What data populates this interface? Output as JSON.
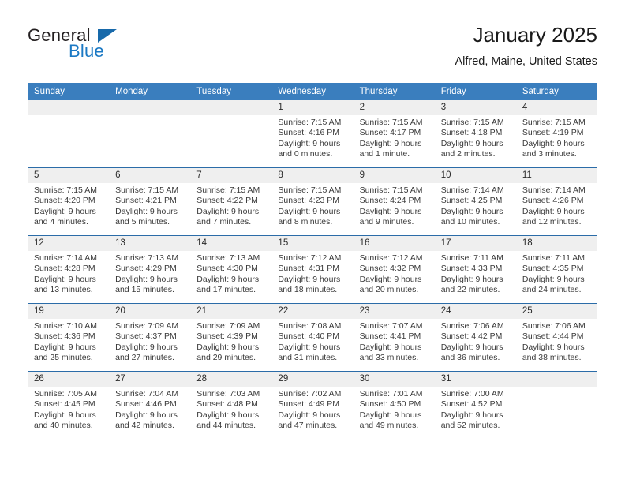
{
  "brand": {
    "name_top": "General",
    "name_bottom": "Blue",
    "color_dark": "#231f20",
    "color_blue": "#1b79c4",
    "triangle_color": "#1769aa"
  },
  "header": {
    "title": "January 2025",
    "subtitle": "Alfred, Maine, United States"
  },
  "theme": {
    "header_row_bg": "#3a7ebe",
    "header_row_text": "#ffffff",
    "daynum_bg": "#efefef",
    "grid_line": "#2b6ca8"
  },
  "weekdays": [
    "Sunday",
    "Monday",
    "Tuesday",
    "Wednesday",
    "Thursday",
    "Friday",
    "Saturday"
  ],
  "labels": {
    "sunrise_prefix": "Sunrise:",
    "sunset_prefix": "Sunset:",
    "daylight_prefix": "Daylight:"
  },
  "weeks": [
    [
      {
        "day": "",
        "empty": true
      },
      {
        "day": "",
        "empty": true
      },
      {
        "day": "",
        "empty": true
      },
      {
        "day": "1",
        "sunrise": "Sunrise: 7:15 AM",
        "sunset": "Sunset: 4:16 PM",
        "daylight": "Daylight: 9 hours and 0 minutes."
      },
      {
        "day": "2",
        "sunrise": "Sunrise: 7:15 AM",
        "sunset": "Sunset: 4:17 PM",
        "daylight": "Daylight: 9 hours and 1 minute."
      },
      {
        "day": "3",
        "sunrise": "Sunrise: 7:15 AM",
        "sunset": "Sunset: 4:18 PM",
        "daylight": "Daylight: 9 hours and 2 minutes."
      },
      {
        "day": "4",
        "sunrise": "Sunrise: 7:15 AM",
        "sunset": "Sunset: 4:19 PM",
        "daylight": "Daylight: 9 hours and 3 minutes."
      }
    ],
    [
      {
        "day": "5",
        "sunrise": "Sunrise: 7:15 AM",
        "sunset": "Sunset: 4:20 PM",
        "daylight": "Daylight: 9 hours and 4 minutes."
      },
      {
        "day": "6",
        "sunrise": "Sunrise: 7:15 AM",
        "sunset": "Sunset: 4:21 PM",
        "daylight": "Daylight: 9 hours and 5 minutes."
      },
      {
        "day": "7",
        "sunrise": "Sunrise: 7:15 AM",
        "sunset": "Sunset: 4:22 PM",
        "daylight": "Daylight: 9 hours and 7 minutes."
      },
      {
        "day": "8",
        "sunrise": "Sunrise: 7:15 AM",
        "sunset": "Sunset: 4:23 PM",
        "daylight": "Daylight: 9 hours and 8 minutes."
      },
      {
        "day": "9",
        "sunrise": "Sunrise: 7:15 AM",
        "sunset": "Sunset: 4:24 PM",
        "daylight": "Daylight: 9 hours and 9 minutes."
      },
      {
        "day": "10",
        "sunrise": "Sunrise: 7:14 AM",
        "sunset": "Sunset: 4:25 PM",
        "daylight": "Daylight: 9 hours and 10 minutes."
      },
      {
        "day": "11",
        "sunrise": "Sunrise: 7:14 AM",
        "sunset": "Sunset: 4:26 PM",
        "daylight": "Daylight: 9 hours and 12 minutes."
      }
    ],
    [
      {
        "day": "12",
        "sunrise": "Sunrise: 7:14 AM",
        "sunset": "Sunset: 4:28 PM",
        "daylight": "Daylight: 9 hours and 13 minutes."
      },
      {
        "day": "13",
        "sunrise": "Sunrise: 7:13 AM",
        "sunset": "Sunset: 4:29 PM",
        "daylight": "Daylight: 9 hours and 15 minutes."
      },
      {
        "day": "14",
        "sunrise": "Sunrise: 7:13 AM",
        "sunset": "Sunset: 4:30 PM",
        "daylight": "Daylight: 9 hours and 17 minutes."
      },
      {
        "day": "15",
        "sunrise": "Sunrise: 7:12 AM",
        "sunset": "Sunset: 4:31 PM",
        "daylight": "Daylight: 9 hours and 18 minutes."
      },
      {
        "day": "16",
        "sunrise": "Sunrise: 7:12 AM",
        "sunset": "Sunset: 4:32 PM",
        "daylight": "Daylight: 9 hours and 20 minutes."
      },
      {
        "day": "17",
        "sunrise": "Sunrise: 7:11 AM",
        "sunset": "Sunset: 4:33 PM",
        "daylight": "Daylight: 9 hours and 22 minutes."
      },
      {
        "day": "18",
        "sunrise": "Sunrise: 7:11 AM",
        "sunset": "Sunset: 4:35 PM",
        "daylight": "Daylight: 9 hours and 24 minutes."
      }
    ],
    [
      {
        "day": "19",
        "sunrise": "Sunrise: 7:10 AM",
        "sunset": "Sunset: 4:36 PM",
        "daylight": "Daylight: 9 hours and 25 minutes."
      },
      {
        "day": "20",
        "sunrise": "Sunrise: 7:09 AM",
        "sunset": "Sunset: 4:37 PM",
        "daylight": "Daylight: 9 hours and 27 minutes."
      },
      {
        "day": "21",
        "sunrise": "Sunrise: 7:09 AM",
        "sunset": "Sunset: 4:39 PM",
        "daylight": "Daylight: 9 hours and 29 minutes."
      },
      {
        "day": "22",
        "sunrise": "Sunrise: 7:08 AM",
        "sunset": "Sunset: 4:40 PM",
        "daylight": "Daylight: 9 hours and 31 minutes."
      },
      {
        "day": "23",
        "sunrise": "Sunrise: 7:07 AM",
        "sunset": "Sunset: 4:41 PM",
        "daylight": "Daylight: 9 hours and 33 minutes."
      },
      {
        "day": "24",
        "sunrise": "Sunrise: 7:06 AM",
        "sunset": "Sunset: 4:42 PM",
        "daylight": "Daylight: 9 hours and 36 minutes."
      },
      {
        "day": "25",
        "sunrise": "Sunrise: 7:06 AM",
        "sunset": "Sunset: 4:44 PM",
        "daylight": "Daylight: 9 hours and 38 minutes."
      }
    ],
    [
      {
        "day": "26",
        "sunrise": "Sunrise: 7:05 AM",
        "sunset": "Sunset: 4:45 PM",
        "daylight": "Daylight: 9 hours and 40 minutes."
      },
      {
        "day": "27",
        "sunrise": "Sunrise: 7:04 AM",
        "sunset": "Sunset: 4:46 PM",
        "daylight": "Daylight: 9 hours and 42 minutes."
      },
      {
        "day": "28",
        "sunrise": "Sunrise: 7:03 AM",
        "sunset": "Sunset: 4:48 PM",
        "daylight": "Daylight: 9 hours and 44 minutes."
      },
      {
        "day": "29",
        "sunrise": "Sunrise: 7:02 AM",
        "sunset": "Sunset: 4:49 PM",
        "daylight": "Daylight: 9 hours and 47 minutes."
      },
      {
        "day": "30",
        "sunrise": "Sunrise: 7:01 AM",
        "sunset": "Sunset: 4:50 PM",
        "daylight": "Daylight: 9 hours and 49 minutes."
      },
      {
        "day": "31",
        "sunrise": "Sunrise: 7:00 AM",
        "sunset": "Sunset: 4:52 PM",
        "daylight": "Daylight: 9 hours and 52 minutes."
      },
      {
        "day": "",
        "empty": true
      }
    ]
  ]
}
